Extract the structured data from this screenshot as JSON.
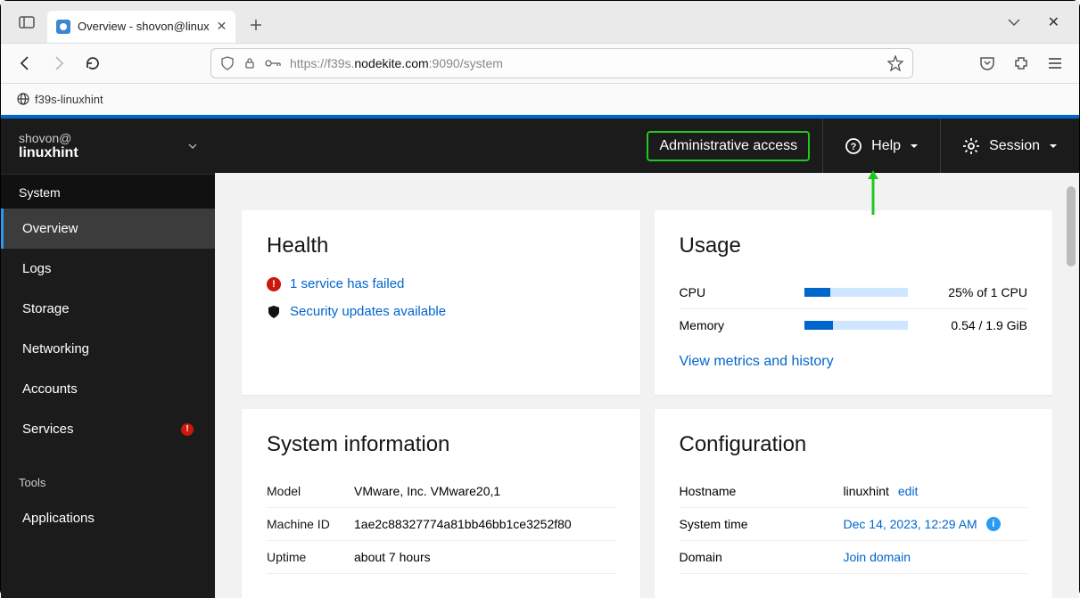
{
  "browser": {
    "tab_title": "Overview - shovon@linux",
    "url_prefix": "https://f39s.",
    "url_domain": "nodekite.com",
    "url_suffix": ":9090/system",
    "hostline": "f39s-linuxhint"
  },
  "sidebar": {
    "user_at": "shovon@",
    "user_host": "linuxhint",
    "section1": "System",
    "items": [
      {
        "label": "Overview"
      },
      {
        "label": "Logs"
      },
      {
        "label": "Storage"
      },
      {
        "label": "Networking"
      },
      {
        "label": "Accounts"
      },
      {
        "label": "Services"
      }
    ],
    "section2": "Tools",
    "items2": [
      {
        "label": "Applications"
      }
    ]
  },
  "topbar": {
    "admin": "Administrative access",
    "help": "Help",
    "session": "Session"
  },
  "health": {
    "title": "Health",
    "failed": "1 service has failed",
    "security": "Security updates available"
  },
  "usage": {
    "title": "Usage",
    "cpu_label": "CPU",
    "cpu_val": "25% of 1 CPU",
    "cpu_pct": 25,
    "mem_label": "Memory",
    "mem_val": "0.54 / 1.9 GiB",
    "mem_pct": 28,
    "metrics_link": "View metrics and history"
  },
  "sysinfo": {
    "title": "System information",
    "rows": [
      {
        "label": "Model",
        "value": "VMware, Inc. VMware20,1"
      },
      {
        "label": "Machine ID",
        "value": "1ae2c88327774a81bb46bb1ce3252f80"
      },
      {
        "label": "Uptime",
        "value": "about 7 hours"
      }
    ]
  },
  "config": {
    "title": "Configuration",
    "hostname_label": "Hostname",
    "hostname_value": "linuxhint",
    "edit": "edit",
    "systime_label": "System time",
    "systime_value": "Dec 14, 2023, 12:29 AM",
    "domain_label": "Domain",
    "domain_value": "Join domain"
  }
}
